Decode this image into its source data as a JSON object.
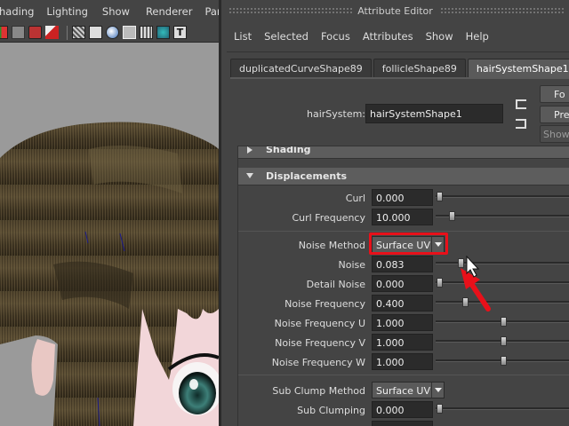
{
  "viewport": {
    "menu": [
      "hading",
      "Lighting",
      "Show",
      "Renderer",
      "Panels"
    ],
    "toolbar_icons": [
      "grid-snap-icon",
      "camera-icon",
      "paint-icon",
      "wireframe-icon",
      "shaded-icon",
      "smooth-shade-icon",
      "sphere-icon",
      "textured-icon",
      "lights-icon",
      "texture-T-icon"
    ],
    "scene": "hair-render"
  },
  "attribute_editor": {
    "title": "Attribute Editor",
    "menu": [
      "List",
      "Selected",
      "Focus",
      "Attributes",
      "Show",
      "Help"
    ],
    "tabs": [
      "duplicatedCurveShape89",
      "follicleShape89",
      "hairSystemShape1"
    ],
    "active_tab": 2,
    "node_label": "hairSystem:",
    "node_value": "hairSystemShape1",
    "side_buttons": [
      "Fo",
      "Pre",
      "Show"
    ],
    "sections": [
      {
        "title": "Shading",
        "expanded": false
      },
      {
        "title": "Displacements",
        "expanded": true
      }
    ],
    "attributes": {
      "curl": {
        "label": "Curl",
        "value": "0.000",
        "slider": 0.0
      },
      "curl_frequency": {
        "label": "Curl Frequency",
        "value": "10.000",
        "slider": 0.1
      },
      "noise_method": {
        "label": "Noise Method",
        "value": "Surface UV"
      },
      "noise": {
        "label": "Noise",
        "value": "0.083",
        "slider": 0.17
      },
      "detail_noise": {
        "label": "Detail Noise",
        "value": "0.000",
        "slider": 0.0
      },
      "noise_frequency": {
        "label": "Noise Frequency",
        "value": "0.400",
        "slider": 0.2
      },
      "noise_frequency_u": {
        "label": "Noise Frequency U",
        "value": "1.000",
        "slider": 0.5
      },
      "noise_frequency_v": {
        "label": "Noise Frequency V",
        "value": "1.000",
        "slider": 0.5
      },
      "noise_frequency_w": {
        "label": "Noise Frequency W",
        "value": "1.000",
        "slider": 0.5
      },
      "sub_clump_method": {
        "label": "Sub Clump Method",
        "value": "Surface UV"
      },
      "sub_clumping": {
        "label": "Sub Clumping",
        "value": "0.000",
        "slider": 0.0
      }
    }
  },
  "colors": {
    "panel_bg": "#444444",
    "field_bg": "#2b2b2b",
    "section_bg": "#5d5d5d",
    "highlight": "#e8101a"
  }
}
